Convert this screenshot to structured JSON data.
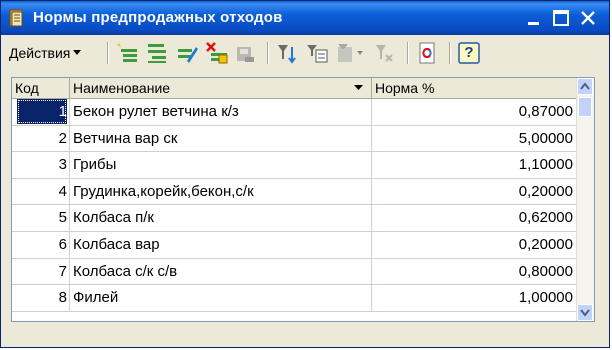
{
  "window": {
    "title": "Нормы предпродажных отходов",
    "icon": "book-icon"
  },
  "toolbar": {
    "actions_label": "Действия",
    "icons": [
      "add-icon",
      "add-copy-icon",
      "edit-icon",
      "delete-icon",
      "save-icon",
      "filter-icon",
      "filter-list-icon",
      "filter-dropdown-icon",
      "filter-clear-icon",
      "refresh-icon",
      "help-icon"
    ],
    "help_label": "?"
  },
  "table": {
    "columns": [
      {
        "key": "code",
        "label": "Код"
      },
      {
        "key": "name",
        "label": "Наименование"
      },
      {
        "key": "norm",
        "label": "Норма %"
      }
    ],
    "rows": [
      {
        "code": "1",
        "name": "Бекон рулет ветчина к/з",
        "norm": "0,87000",
        "selected": true
      },
      {
        "code": "2",
        "name": "Ветчина вар ск",
        "norm": "5,00000"
      },
      {
        "code": "3",
        "name": "Грибы",
        "norm": "1,10000"
      },
      {
        "code": "4",
        "name": "Грудинка,корейк,бекон,с/к",
        "norm": "0,20000"
      },
      {
        "code": "5",
        "name": "Колбаса  п/к",
        "norm": "0,62000"
      },
      {
        "code": "6",
        "name": "Колбаса вар",
        "norm": "0,20000"
      },
      {
        "code": "7",
        "name": "Колбаса с/к с/в",
        "norm": "0,80000"
      },
      {
        "code": "8",
        "name": "Филей",
        "norm": "1,00000"
      }
    ]
  },
  "colors": {
    "titlebar": "#0a5fd8",
    "selection": "#0a246a",
    "window_bg": "#ece9d8"
  }
}
